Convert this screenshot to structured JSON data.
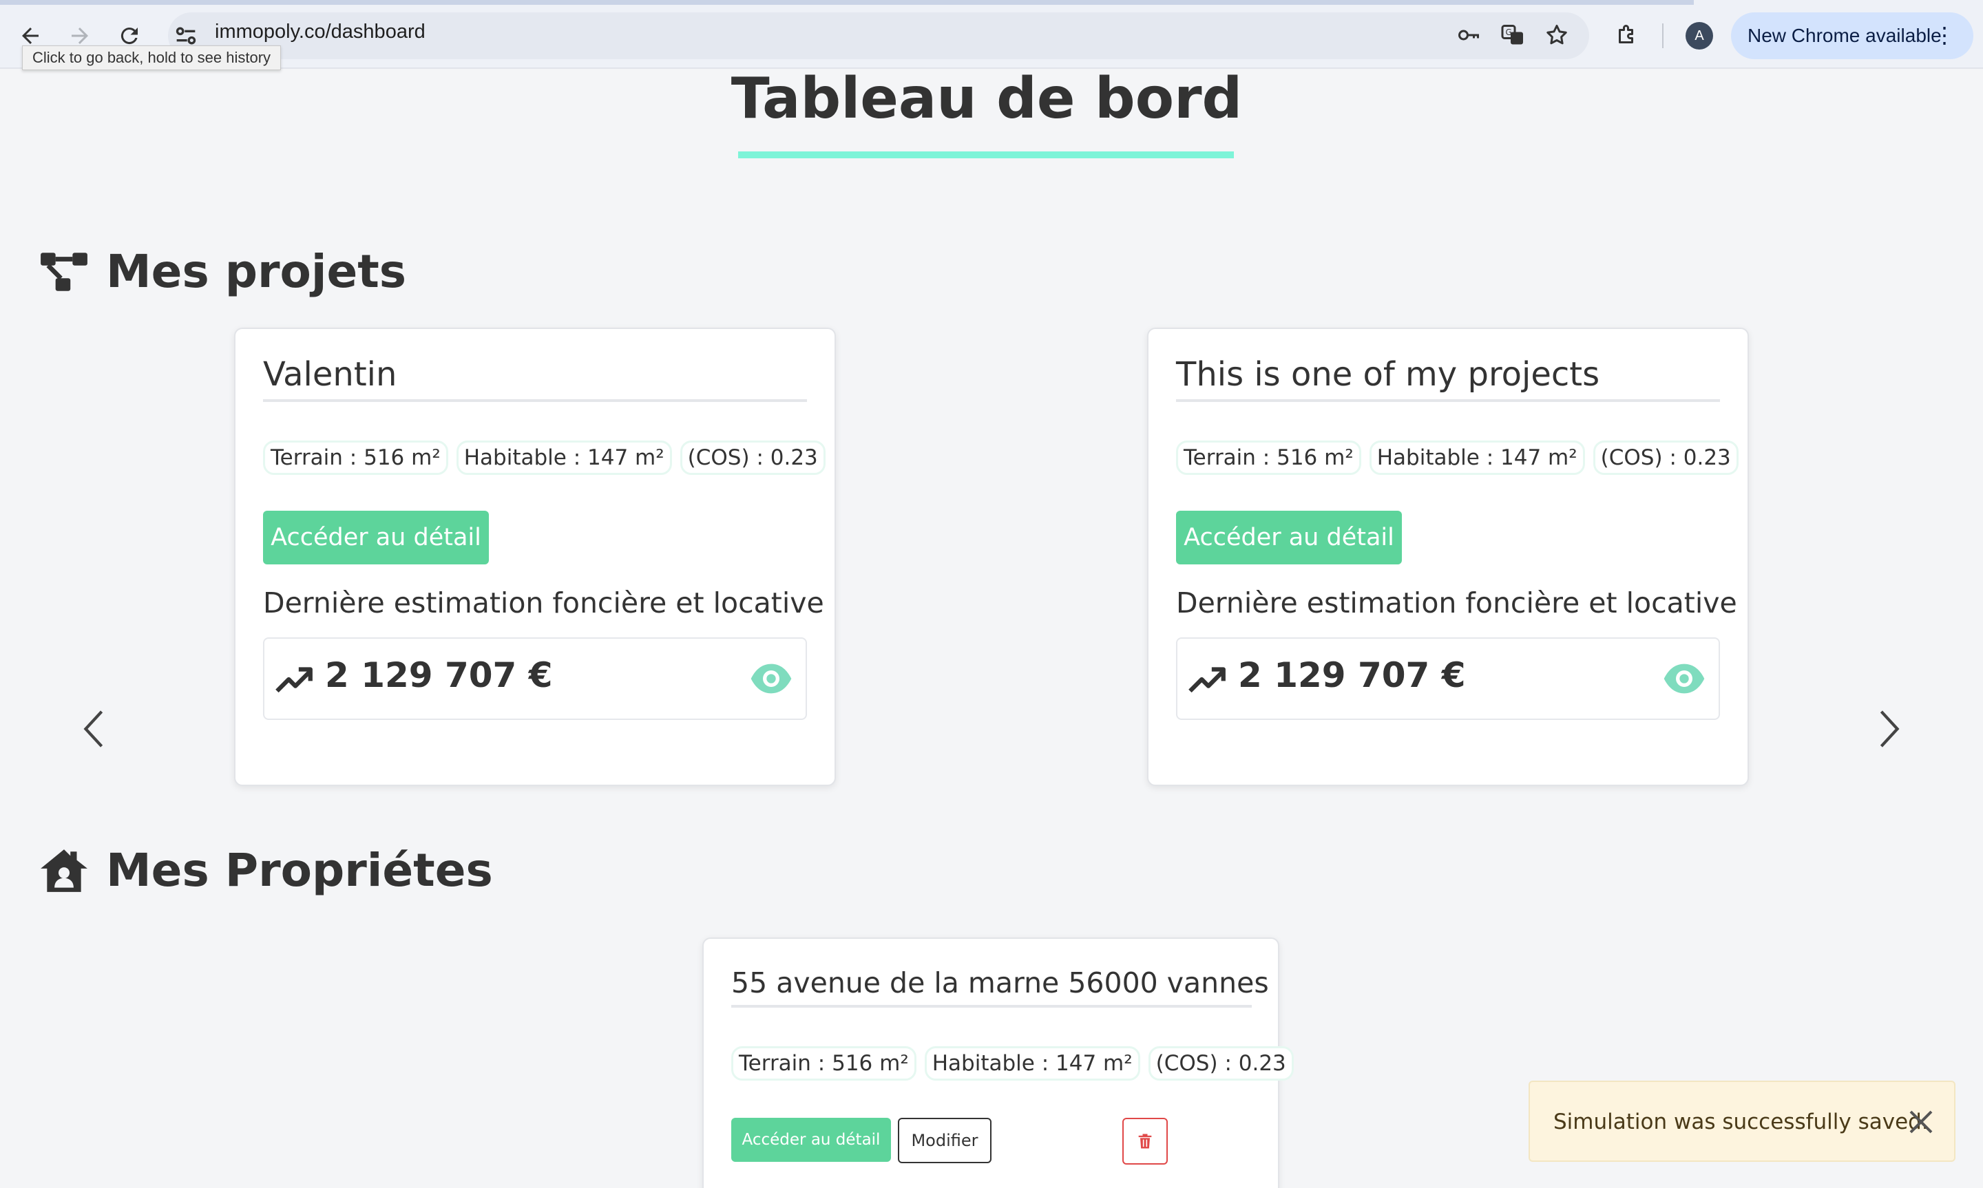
{
  "browser": {
    "url": "immopoly.co/dashboard",
    "tooltip": "Click to go back, hold to see history",
    "avatar_letter": "A",
    "update_label": "New Chrome available",
    "kebab": "⋮"
  },
  "page": {
    "title": "Tableau de bord",
    "accent_color": "#7ef4d8",
    "green_color": "#5dd49b"
  },
  "projects": {
    "heading": "Mes projets",
    "heading_icon": "project-diagram-icon",
    "cards": [
      {
        "title": "Valentin",
        "tags": [
          "Terrain : 516 m²",
          "Habitable : 147 m²",
          "(COS) : 0.23"
        ],
        "detail_button": "Accéder au détail",
        "estimate_label": "Dernière estimation foncière et locative",
        "estimate_value": "2 129 707 €"
      },
      {
        "title": "This is one of my projects",
        "tags": [
          "Terrain : 516 m²",
          "Habitable : 147 m²",
          "(COS) : 0.23"
        ],
        "detail_button": "Accéder au détail",
        "estimate_label": "Dernière estimation foncière et locative",
        "estimate_value": "2 129 707 €"
      }
    ]
  },
  "properties": {
    "heading": "Mes Propriétes",
    "heading_icon": "house-user-icon",
    "cards": [
      {
        "title": "55 avenue de la marne 56000 vannes",
        "tags": [
          "Terrain : 516 m²",
          "Habitable : 147 m²",
          "(COS) : 0.23"
        ],
        "detail_button": "Accéder au détail",
        "edit_button": "Modifier"
      }
    ]
  },
  "toast": {
    "message": "Simulation was successfully saved."
  }
}
